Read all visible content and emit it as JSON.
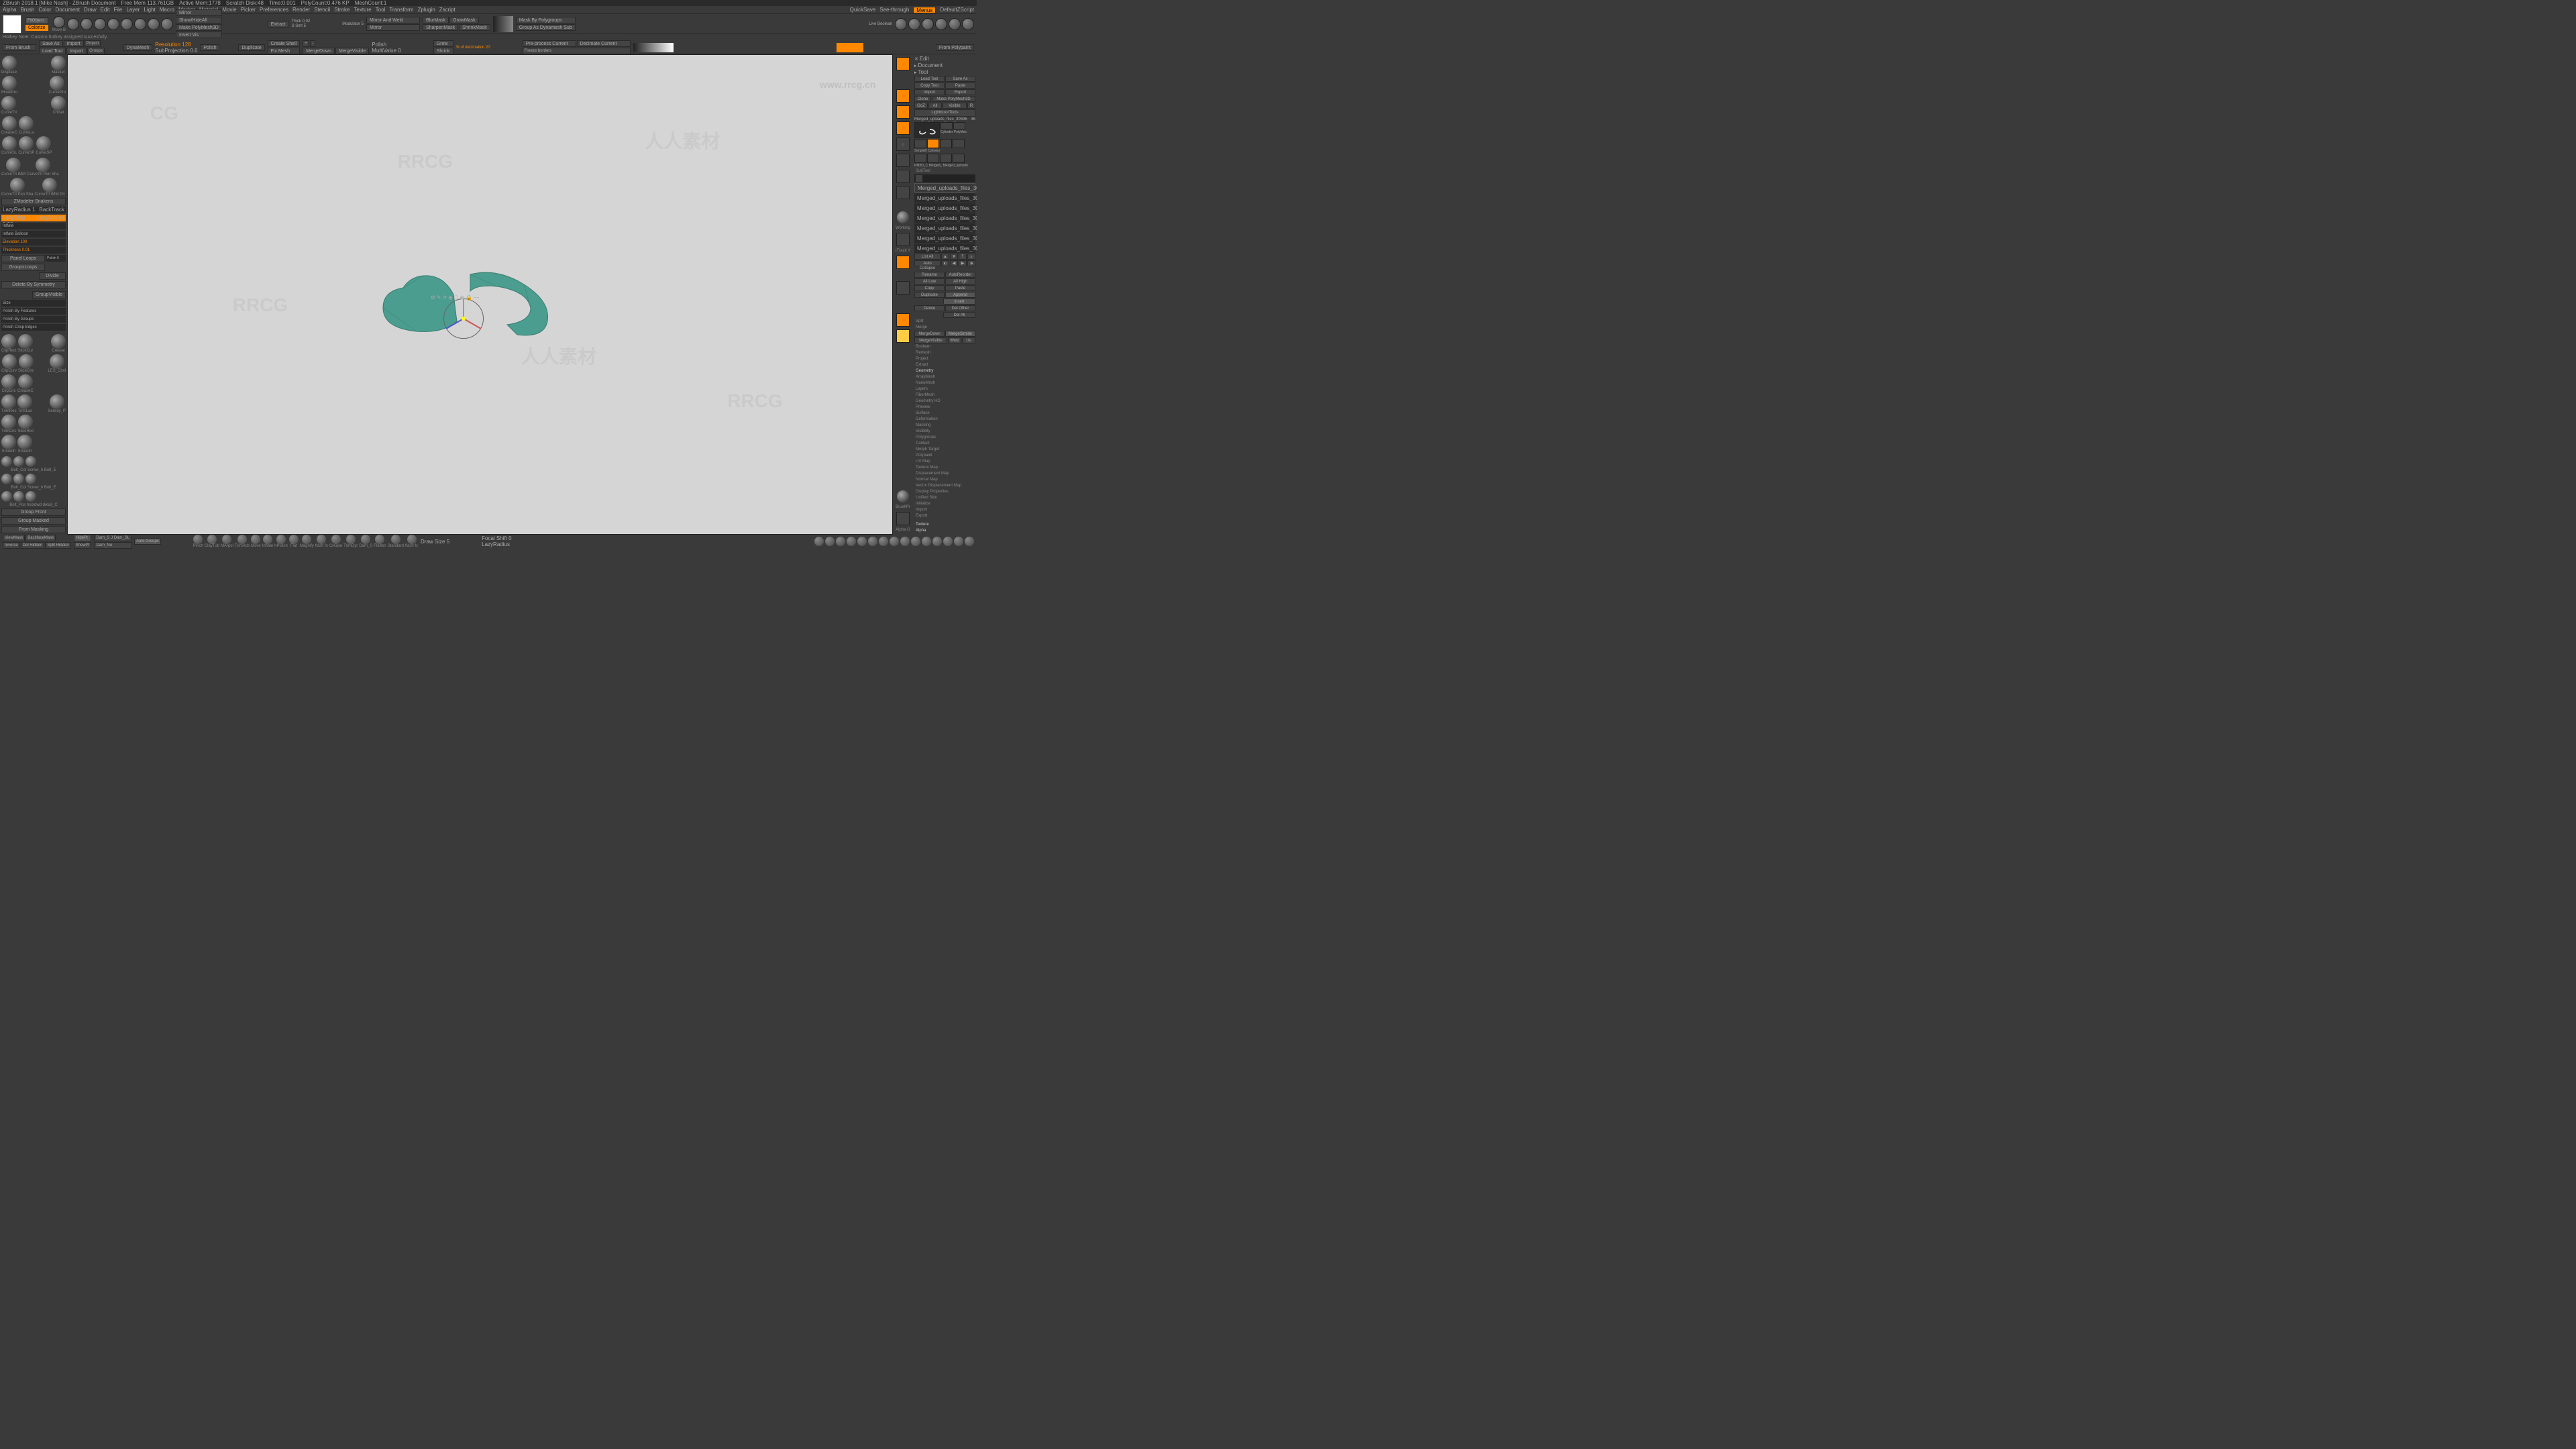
{
  "title_bar": {
    "app": "ZBrush 2018.1 [Mike Nash] - ZBrush Document",
    "mem": "Free Mem 113.761GB",
    "active": "Active Mem:1778",
    "scratch": "Scratch Disk:48",
    "timer": "Time:0.001",
    "poly": "PolyCount:0.476 KP",
    "mesh": "MeshCount:1"
  },
  "menu": [
    "Alpha",
    "Brush",
    "Color",
    "Document",
    "Draw",
    "Edit",
    "File",
    "Layer",
    "Light",
    "Macro",
    "Marker",
    "Material",
    "Movie",
    "Picker",
    "Preferences",
    "Render",
    "Stencil",
    "Stroke",
    "Texture",
    "Tool",
    "Transform",
    "Zplugin",
    "Zscript"
  ],
  "menu_right": [
    "QuickSave",
    "See-through",
    "Menus",
    "DefaultZScript"
  ],
  "hotkey_note": "Hotkey Note: Custom hotkey assigned succesfully.",
  "top_dropdowns": {
    "fit": "FitObject",
    "colorize": "Colorize"
  },
  "toolbar_labels": {
    "move": "Move B",
    "dynamesh": "DynaMesh",
    "mirror": "Mirror",
    "show_hide": "Show/HideAll",
    "make_poly": "Make PolyMesh3D",
    "invert_vis": "Invert Vis",
    "extract": "Extract",
    "thick": "Thick 0.02",
    "ssmt": "S Smt 5",
    "modulator": "Modulator 5",
    "mirror_weld": "Mirror And Weld",
    "mirror2": "Mirror",
    "blur_mask": "BlurMask",
    "sharpen": "SharpenMask",
    "grow_mask": "GrowMask",
    "shrink_mask": "ShrinkMask",
    "mask_poly": "Mask By Polygroups",
    "group_dyna": "Group As Dynamesh Sub",
    "live_bool": "Live Boolean",
    "flash": "flash fx"
  },
  "toolbar2": {
    "from_brush": "From Brush",
    "save_as": "Save As",
    "import": "Import",
    "project": "Project",
    "load_tool": "Load Tool",
    "import2": "Import",
    "groups": "Groups",
    "res": "Resolution 128",
    "polish": "Polish",
    "sub_proj": "SubProjection 0.6",
    "duplicate": "Duplicate",
    "create_shell": "Create Shell",
    "fix_mesh": "Fix Mesh",
    "merge_down": "MergeDown",
    "merge_vis": "MergeVisible",
    "multi_value": "MultiValue 0",
    "grow": "Grow",
    "shrink": "Shrink",
    "decimation": "% of decimation 20",
    "preprocess": "Pre-process Current",
    "decimate": "Decimate Current",
    "freeze": "Freeze borders",
    "from_polypaint": "From Polypaint"
  },
  "left_brushes": [
    "Displace",
    "Masker",
    "MovePro",
    "CurvePro",
    "CurveTri",
    "Chisel",
    "CreaseC",
    "CurveLa",
    "CurveSL",
    "CurveSP",
    "CurveSP",
    "CurveTri IMM",
    "CurveTri Pen Sha",
    "CurveTri IMM Pri",
    "ZModeler Snakens"
  ],
  "left_controls": {
    "lazy_radius": "LazyRadius 1",
    "back_track": "BackTrack",
    "lazy_step": "LazyStep 0.28",
    "lazy_mouse": "LazyMouse",
    "inflate": "Inflate",
    "inflate_bal": "Inflate Balloon",
    "elevation": "Elevation 100",
    "thickness": "Thickness 0.01",
    "panel_loops": "Panel Loops",
    "groups_loops": "GroupsLoops",
    "divide": "Divide",
    "del_sym": "Delete By Symmetry",
    "group_vis": "GroupVisible",
    "size": "Size",
    "polish_feat": "Polish By Features",
    "polish_groups": "Polish By Groups",
    "polish_crisp": "Polish Crisp Edges"
  },
  "left_brushes2": [
    "ClipRect",
    "SliceCur",
    "Crease",
    "ClipCurv",
    "SliceCirc",
    "LES_Clotl",
    "ClipCirc",
    "CreaseC",
    "TrimRec",
    "TrimLas",
    "Selway_P",
    "TrimCirc",
    "SliceRec",
    "Smooth",
    "Smooth"
  ],
  "left_brushes3": [
    "Bolt_Col Screw_h Bolt_E",
    "Bolt_Col Screw_h Bolt_E",
    "Bolt_Pos hsoldwd detail_C",
    "Group Front",
    "Group Masked",
    "From Masking"
  ],
  "right_top": {
    "edit": "Edit",
    "document": "Document",
    "tool": "Tool"
  },
  "right_panel": {
    "load_tool": "Load Tool",
    "save_as": "Save As",
    "copy_tool": "Copy Tool",
    "paste": "Paste",
    "import": "Import",
    "export": "Export",
    "clone": "Clone",
    "make_poly": "Make PolyMesh3D",
    "goz": "GoZ",
    "all": "All",
    "visible": "Visible",
    "r": "R",
    "lightbox": "Lightbox>Tools",
    "tool_name": "Merged_uploads_files_30595",
    "tool_count": "35",
    "cylinder": "Cylinder PolyMes",
    "simple": "SimpleB Cylinder",
    "merged": "Merged uploads",
    "pm3d": "PM3D_C Merged_ Merged_uploads",
    "list_all": "List All",
    "auto_collapse": "Auto Collapse",
    "rename": "Rename",
    "auto_reorder": "AutoReorder",
    "all_low": "All Low",
    "all_high": "All High",
    "copy": "Copy",
    "paste2": "Paste",
    "duplicate": "Duplicate",
    "append": "Append",
    "insert": "Insert",
    "delete": "Delete",
    "del_other": "Del Other",
    "del_all": "Del All",
    "split": "Split",
    "merge": "Merge",
    "merge_down": "MergeDown",
    "merge_similar": "MergeSimilar",
    "merge_visible": "MergeVisible",
    "weld": "Weld",
    "uv": "Uv",
    "boolean": "Boolean",
    "remesh": "Remesh",
    "project": "Project",
    "extract": "Extract"
  },
  "subtool_name": "Merged_uploads_files_305956",
  "geometry_sections": [
    "Geometry",
    "ArrayMesh",
    "NanoMesh",
    "Layers",
    "FiberMesh",
    "Geometry HD",
    "Preview",
    "Surface",
    "Deformation",
    "Masking",
    "Visibility",
    "Polygroups",
    "Contact",
    "Morph Target",
    "Polypaint",
    "UV Map",
    "Texture Map",
    "Displacement Map",
    "Normal Map",
    "Vector Displacement Map",
    "Display Properties",
    "Unified Skin",
    "Initialize",
    "Import",
    "Export"
  ],
  "right_dock_labels": [
    "Working",
    "rTrack Y",
    "rTrack",
    "BrushPr",
    "Alpha O"
  ],
  "bottom_bar": {
    "view_mask": "ViewMask",
    "backface": "BackfaceMask",
    "hide_pt": "HidePt",
    "inverse": "Inverse",
    "del_hidden": "Del Hidden",
    "split_hidden": "Split Hidden",
    "show_pt": "ShowPt",
    "auto_groups": "Auto Groups",
    "dam_std": "Dam_S J Dam_SL",
    "dam_nu": "Dam_Nu",
    "draw_size": "Draw Size 5",
    "focal": "Focal Shift 0",
    "lazy_rad": "LazyRadius"
  },
  "bottom_brushes": [
    "Pinch",
    "ClayTub",
    "MArpol",
    "TrimAds",
    "Move",
    "Inflate",
    "hPolish",
    "Flat",
    "Magnify",
    "flash fx",
    "Crease",
    "TrimDyr",
    "Dam_S",
    "Flatten",
    "Standard",
    "flash fx"
  ],
  "right_sections": [
    "Texture",
    "Alpha"
  ]
}
